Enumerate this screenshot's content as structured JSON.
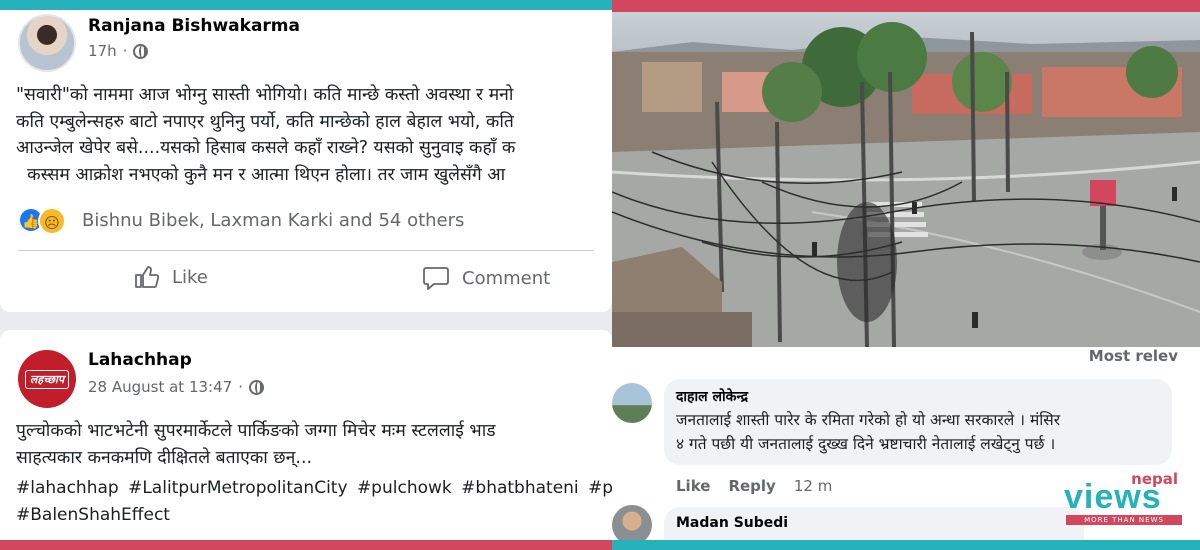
{
  "colors": {
    "accent_teal": "#27b2bb",
    "accent_red": "#d2475e",
    "fb_blue": "#1877f2"
  },
  "post1": {
    "author": "Ranjana Bishwakarma",
    "time": "17h",
    "lines": [
      "\"सवारी\"को नाममा आज भोग्नु सास्ती भोगियो। कति मान्छे कस्तो अवस्था र मनो",
      "कति एम्बुलेन्सहरु बाटो नपाएर थुनिनु पर्यो, कति मान्छेको हाल बेहाल भयो, कति",
      "आउन्जेल खेपेर बसे....यसको हिसाब कसले कहाँ राख्ने? यसको सुनुवाइ कहाँ क",
      "  कस्सम आक्रोश नभएको कुनै मन र आत्मा थिएन होला। तर जाम खुलेसँगै आ"
    ],
    "reactions": "Bishnu Bibek, Laxman Karki and 54 others",
    "like_label": "Like",
    "comment_label": "Comment"
  },
  "post2": {
    "author": "Lahachhap",
    "time": "28 August at 13:47",
    "logo_text": "लहच्छाप",
    "lines": [
      "पुल्चोकको भाटभटेनी सुपरमार्केटले पार्किङको जग्गा मिचेर मःम स्टललाई भाड",
      "साहत्यकार कनकमणि दीक्षितले बताएका छन्..."
    ],
    "hashtags_line1": [
      "#lahachhap",
      "#LalitpurMetropolitanCity",
      "#pulchowk",
      "#bhatbhateni",
      "#p"
    ],
    "hashtags_line2": [
      "#BalenShahEffect"
    ]
  },
  "comments": {
    "sort_label": "Most relev",
    "c1": {
      "author": "दाहाल लोकेन्द्र",
      "text_line1": "जनतालाई शास्ती पारेर के रमिता गरेको हो यो अन्धा सरकारले । मंसिर",
      "text_line2": "४ गते पछी यी जनतालाई दुख्ख दिने भ्रष्टाचारी नेतालाई लखेट्नु पर्छ ।",
      "like_label": "Like",
      "reply_label": "Reply",
      "time": "12 m"
    },
    "c2": {
      "author": "Madan Subedi"
    }
  },
  "watermark": {
    "small": "nepal",
    "big": "views",
    "tagline": "MORE THAN NEWS"
  }
}
